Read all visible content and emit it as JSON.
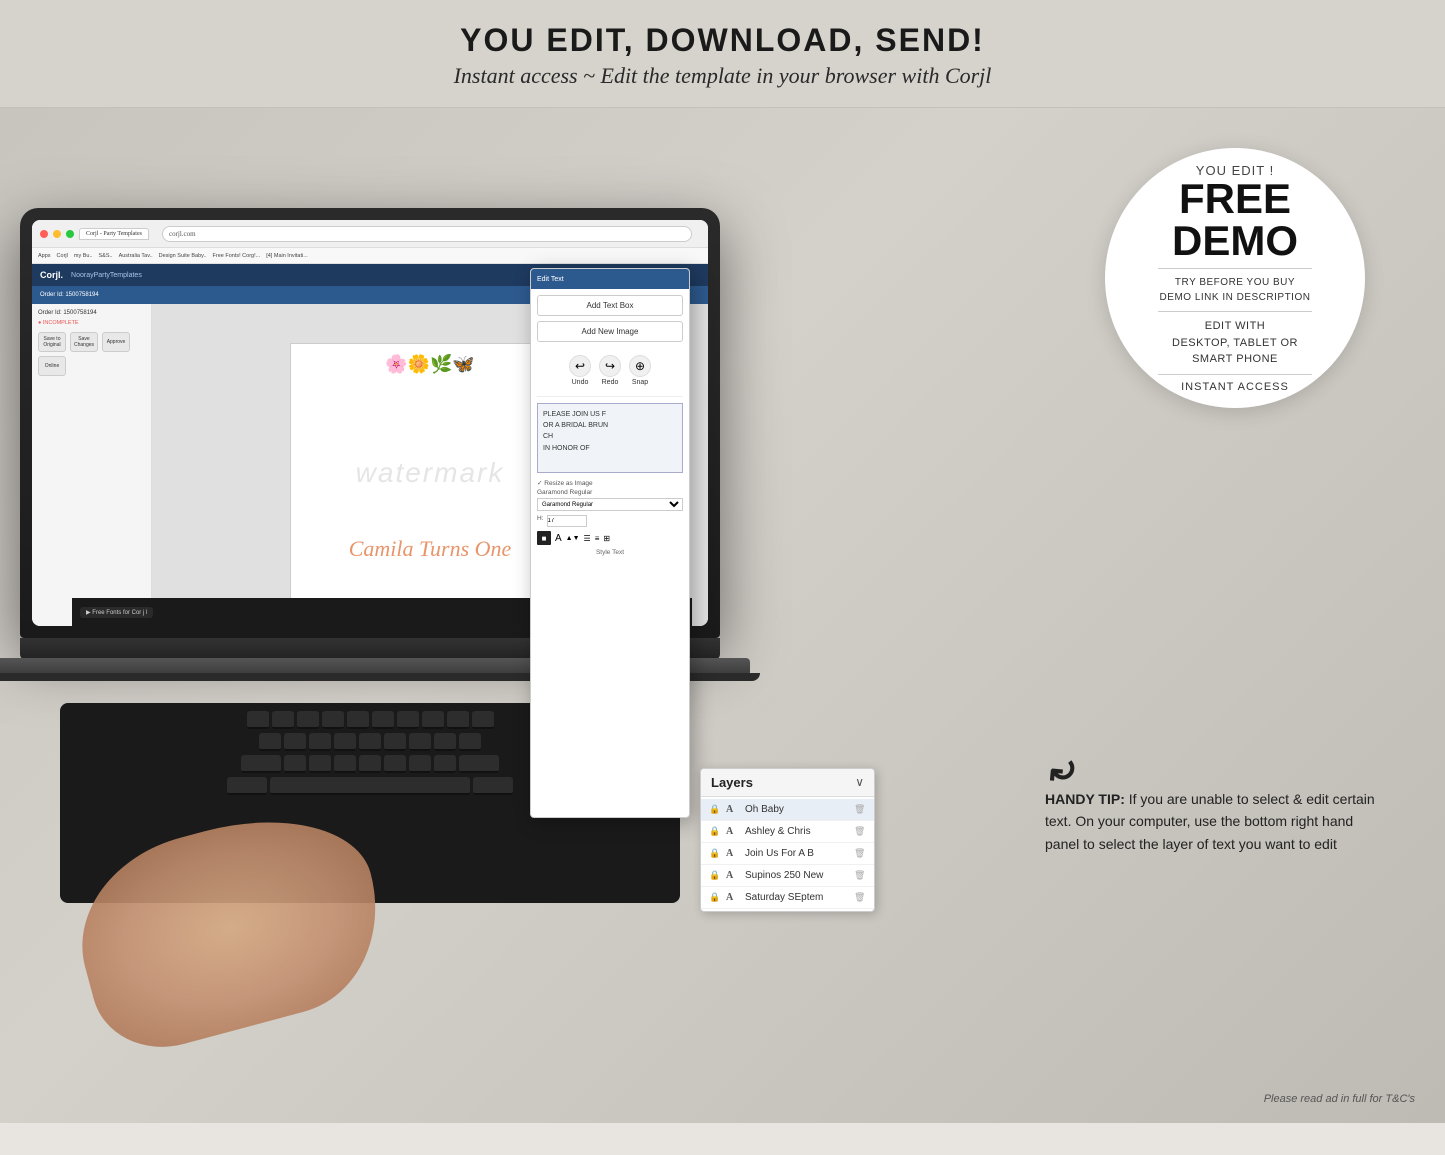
{
  "banner": {
    "headline": "YOU EDIT, DOWNLOAD, SEND!",
    "subheadline": "Instant access ~ Edit the template in your browser with Corjl"
  },
  "demo_circle": {
    "you_edit": "YOU EDIT !",
    "free": "FREE",
    "demo": "DEMO",
    "try_text": "TRY BEFORE YOU BUY\nDEMO LINK IN DESCRIPTION",
    "edit_with": "EDIT WITH\nDESKTOP, TABLET OR\nSMART PHONE",
    "instant": "INSTANT ACCESS"
  },
  "floating_panel": {
    "add_text_box": "Add Text Box",
    "add_new_image": "Add New Image",
    "undo": "Undo",
    "redo": "Redo",
    "snap": "Snap",
    "style_text": "Style Text"
  },
  "layers_panel": {
    "title": "Layers",
    "chevron": "∨",
    "items": [
      {
        "lock": "🔒",
        "type": "A",
        "name": "Oh Baby",
        "selected": true
      },
      {
        "lock": "🔒",
        "type": "A",
        "name": "Ashley & Chris",
        "selected": false
      },
      {
        "lock": "🔒",
        "type": "A",
        "name": "Join Us For A B",
        "selected": false
      },
      {
        "lock": "🔒",
        "type": "A",
        "name": "Supinos 250 New",
        "selected": false
      },
      {
        "lock": "🔒",
        "type": "A",
        "name": "Saturday SEptem",
        "selected": false
      }
    ]
  },
  "handy_tip": {
    "label": "HANDY TIP:",
    "text": "If you are unable to select & edit certain text. On your computer, use the bottom right hand panel to select the layer of text you want to edit"
  },
  "browser": {
    "url": "corjl.com",
    "tab": "Corjl - Party Templates"
  },
  "corjl": {
    "logo": "Corjl.",
    "order_id": "Order Id: 1500758194",
    "status": "● INCOMPLETE",
    "nav_items": [
      "NoorayPartyTemplates"
    ],
    "toolbar_items": [
      "Save to Original",
      "Save Changes",
      "Approve",
      "Online"
    ]
  },
  "canvas": {
    "watermark": "watermark",
    "script_text": "Camila Turns One"
  },
  "disclaimer": "Please read ad in full for T&C's"
}
